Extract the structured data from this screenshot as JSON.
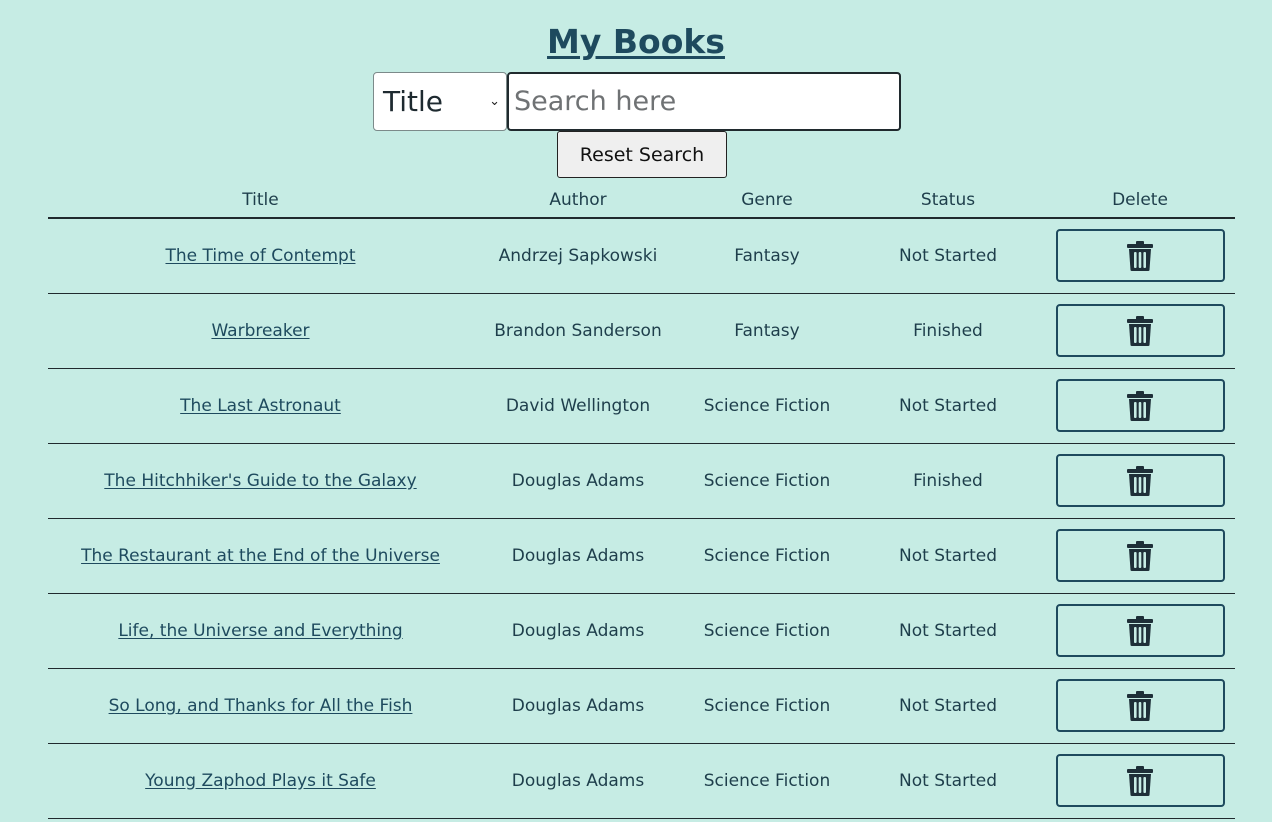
{
  "page": {
    "title": "My Books"
  },
  "search": {
    "field_value": "Title",
    "placeholder": "Search here",
    "reset_label": "Reset Search"
  },
  "table": {
    "headers": [
      "Title",
      "Author",
      "Genre",
      "Status",
      "Delete"
    ],
    "delete_icon": "trash-icon",
    "rows": [
      {
        "title": "The Time of Contempt",
        "author": "Andrzej Sapkowski",
        "genre": "Fantasy",
        "status": "Not Started"
      },
      {
        "title": "Warbreaker",
        "author": "Brandon Sanderson",
        "genre": "Fantasy",
        "status": "Finished"
      },
      {
        "title": "The Last Astronaut",
        "author": "David Wellington",
        "genre": "Science Fiction",
        "status": "Not Started"
      },
      {
        "title": "The Hitchhiker's Guide to the Galaxy",
        "author": "Douglas Adams",
        "genre": "Science Fiction",
        "status": "Finished"
      },
      {
        "title": "The Restaurant at the End of the Universe",
        "author": "Douglas Adams",
        "genre": "Science Fiction",
        "status": "Not Started"
      },
      {
        "title": "Life, the Universe and Everything",
        "author": "Douglas Adams",
        "genre": "Science Fiction",
        "status": "Not Started"
      },
      {
        "title": "So Long, and Thanks for All the Fish",
        "author": "Douglas Adams",
        "genre": "Science Fiction",
        "status": "Not Started"
      },
      {
        "title": "Young Zaphod Plays it Safe",
        "author": "Douglas Adams",
        "genre": "Science Fiction",
        "status": "Not Started"
      }
    ]
  },
  "colors": {
    "background": "#c6ece4",
    "text": "#1e3e4b",
    "link": "#1e4a5e"
  }
}
